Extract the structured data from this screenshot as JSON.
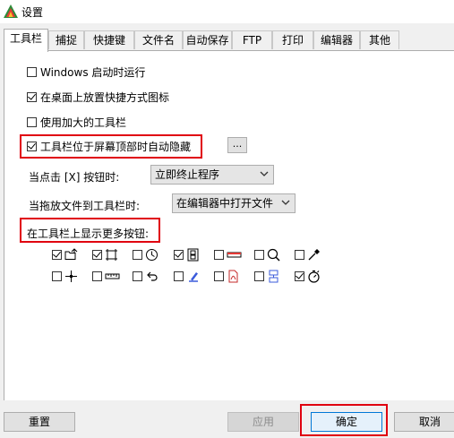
{
  "window": {
    "title": "设置"
  },
  "tabs": [
    {
      "label": "工具栏",
      "active": true
    },
    {
      "label": "捕捉"
    },
    {
      "label": "快捷键"
    },
    {
      "label": "文件名"
    },
    {
      "label": "自动保存"
    },
    {
      "label": "FTP"
    },
    {
      "label": "打印"
    },
    {
      "label": "编辑器"
    },
    {
      "label": "其他"
    }
  ],
  "options": {
    "windows_startup": {
      "label": "Windows 启动时运行",
      "checked": false
    },
    "desktop_shortcut": {
      "label": "在桌面上放置快捷方式图标",
      "checked": true
    },
    "large_toolbar": {
      "label": "使用加大的工具栏",
      "checked": false
    },
    "auto_hide": {
      "label": "工具栏位于屏幕顶部时自动隐藏",
      "checked": true
    },
    "more_button": "..."
  },
  "close_click": {
    "label": "当点击 [X] 按钮时:",
    "value": "立即终止程序"
  },
  "drop_file": {
    "label": "当拖放文件到工具栏时:",
    "value": "在编辑器中打开文件"
  },
  "more_buttons": {
    "heading": "在工具栏上显示更多按钮:",
    "row1": [
      {
        "icon": "open-folder-icon",
        "checked": true
      },
      {
        "icon": "crop-frame-icon",
        "checked": true
      },
      {
        "icon": "timer-clock-icon",
        "checked": false
      },
      {
        "icon": "film-strip-icon",
        "checked": true
      },
      {
        "icon": "window-bar-icon",
        "checked": false
      },
      {
        "icon": "magnifier-icon",
        "checked": false
      },
      {
        "icon": "color-picker-icon",
        "checked": false
      }
    ],
    "row2": [
      {
        "icon": "crosshair-icon",
        "checked": false
      },
      {
        "icon": "ruler-icon",
        "checked": false
      },
      {
        "icon": "undo-arrow-icon",
        "checked": false
      },
      {
        "icon": "pen-tool-icon",
        "checked": false
      },
      {
        "icon": "pdf-icon",
        "checked": false
      },
      {
        "icon": "scroll-capture-icon",
        "checked": false
      },
      {
        "icon": "stopwatch-icon",
        "checked": true
      }
    ]
  },
  "buttons": {
    "reset": "重置",
    "apply": "应用",
    "ok": "确定",
    "cancel": "取消"
  },
  "colors": {
    "highlight": "#e0000f",
    "accent": "#0078d7"
  }
}
